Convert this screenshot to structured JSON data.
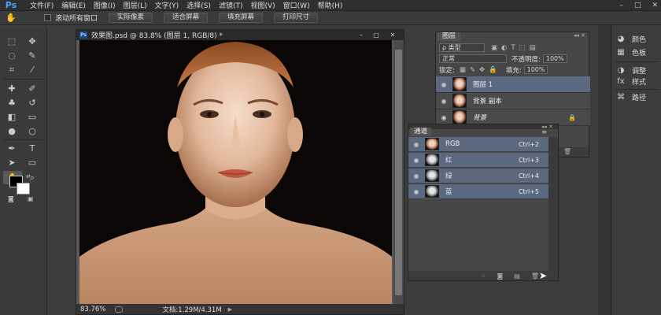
{
  "app": {
    "logo": "Ps"
  },
  "menu": [
    "文件(F)",
    "编辑(E)",
    "图像(I)",
    "图层(L)",
    "文字(Y)",
    "选择(S)",
    "滤镜(T)",
    "视图(V)",
    "窗口(W)",
    "帮助(H)"
  ],
  "window_controls": {
    "minimize": "–",
    "restore": "□",
    "close": "✕"
  },
  "options": {
    "scroll_all_windows": "滚动所有窗口",
    "buttons": [
      "实际像素",
      "适合屏幕",
      "填充屏幕",
      "打印尺寸"
    ]
  },
  "document": {
    "title": "效果图.psd @ 83.8% (图层 1, RGB/8) *",
    "ps_icon": "Ps",
    "zoom": "83.76%",
    "doc_size": "文档:1.29M/4.31M"
  },
  "layers_panel": {
    "tab": "图层",
    "filter_label": "ρ 类型",
    "blend_mode": "正常",
    "opacity_label": "不透明度:",
    "opacity_value": "100%",
    "lock_label": "锁定:",
    "fill_label": "填充:",
    "fill_value": "100%",
    "layers": [
      {
        "name": "图层 1",
        "active": true
      },
      {
        "name": "背景 副本",
        "active": false
      },
      {
        "name": "背景",
        "active": false
      }
    ]
  },
  "channels_panel": {
    "tab": "通道",
    "channels": [
      {
        "name": "RGB",
        "shortcut": "Ctrl+2"
      },
      {
        "name": "红",
        "shortcut": "Ctrl+3"
      },
      {
        "name": "绿",
        "shortcut": "Ctrl+4"
      },
      {
        "name": "蓝",
        "shortcut": "Ctrl+5"
      }
    ]
  },
  "dock": [
    "颜色",
    "色板",
    "调整",
    "样式",
    "路径"
  ],
  "colors": {
    "accent": "#4ea4ff",
    "selection": "#5a6880",
    "panel": "#464646"
  }
}
